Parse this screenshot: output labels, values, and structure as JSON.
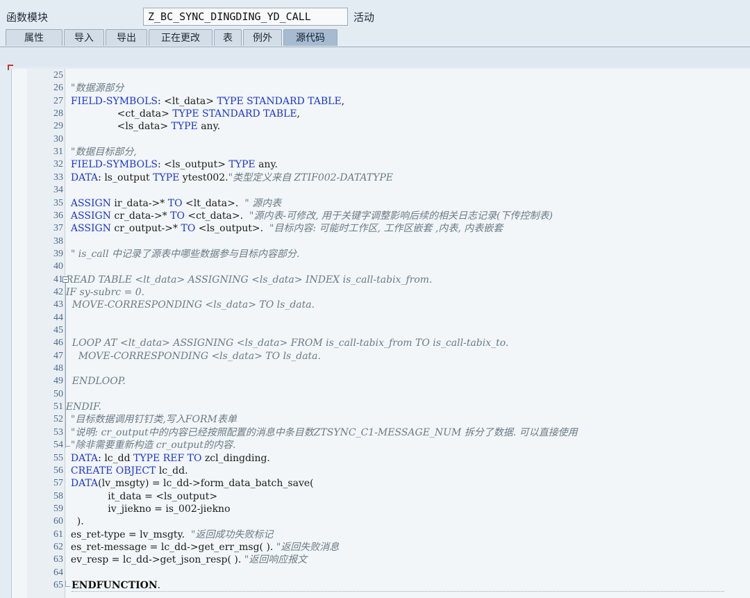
{
  "header": {
    "module_label": "函数模块",
    "function_name": "Z_BC_SYNC_DINGDING_YD_CALL",
    "status": "活动"
  },
  "tabs": [
    {
      "label": "属性",
      "active": false
    },
    {
      "label": "导入",
      "active": false
    },
    {
      "label": "导出",
      "active": false
    },
    {
      "label": "正在更改",
      "active": false
    },
    {
      "label": "表",
      "active": false
    },
    {
      "label": "例外",
      "active": false
    },
    {
      "label": "源代码",
      "active": true
    }
  ],
  "colors": {
    "keyword": "#1a35d6",
    "comment": "#6b7a86",
    "line_number": "#4a6a90",
    "active_tab": "#a6bbd0"
  },
  "code": [
    {
      "n": "25",
      "t": []
    },
    {
      "n": "26",
      "t": [
        [
          "cm",
          "  \"数据源部分"
        ]
      ]
    },
    {
      "n": "27",
      "t": [
        [
          "kw",
          "  FIELD-SYMBOLS"
        ],
        [
          "",
          ": <lt_data> "
        ],
        [
          "kw",
          "TYPE STANDARD TABLE"
        ],
        [
          "",
          ","
        ]
      ]
    },
    {
      "n": "28",
      "t": [
        [
          "",
          "                 <ct_data> "
        ],
        [
          "kw",
          "TYPE STANDARD TABLE"
        ],
        [
          "",
          ","
        ]
      ]
    },
    {
      "n": "29",
      "t": [
        [
          "",
          "                 <ls_data> "
        ],
        [
          "kw",
          "TYPE"
        ],
        [
          "",
          " any."
        ]
      ]
    },
    {
      "n": "30",
      "t": []
    },
    {
      "n": "31",
      "t": [
        [
          "cm",
          "  \"数据目标部分,"
        ]
      ]
    },
    {
      "n": "32",
      "t": [
        [
          "kw",
          "  FIELD-SYMBOLS"
        ],
        [
          "",
          ": <ls_output> "
        ],
        [
          "kw",
          "TYPE"
        ],
        [
          "",
          " any."
        ]
      ]
    },
    {
      "n": "33",
      "t": [
        [
          "kw",
          "  DATA"
        ],
        [
          "",
          ": ls_output "
        ],
        [
          "kw",
          "TYPE"
        ],
        [
          "",
          " ytest002."
        ],
        [
          "cm",
          "\"类型定义来自 ZTIF002-DATATYPE"
        ]
      ]
    },
    {
      "n": "34",
      "t": []
    },
    {
      "n": "35",
      "t": [
        [
          "kw",
          "  ASSIGN"
        ],
        [
          "",
          " ir_data->* "
        ],
        [
          "kw",
          "TO"
        ],
        [
          "",
          " <lt_data>.  "
        ],
        [
          "cm",
          "\" 源内表"
        ]
      ]
    },
    {
      "n": "36",
      "t": [
        [
          "kw",
          "  ASSIGN"
        ],
        [
          "",
          " cr_data->* "
        ],
        [
          "kw",
          "TO"
        ],
        [
          "",
          " <ct_data>.  "
        ],
        [
          "cm",
          "\"源内表-可修改, 用于关键字调整影响后续的相关日志记录(下传控制表)"
        ]
      ]
    },
    {
      "n": "37",
      "t": [
        [
          "kw",
          "  ASSIGN"
        ],
        [
          "",
          " cr_output->* "
        ],
        [
          "kw",
          "TO"
        ],
        [
          "",
          " <ls_output>.  "
        ],
        [
          "cm",
          "\"目标内容: 可能时工作区, 工作区嵌套 ,内表, 内表嵌套"
        ]
      ]
    },
    {
      "n": "38",
      "t": []
    },
    {
      "n": "39",
      "t": [
        [
          "cm",
          "  \" is_call 中记录了源表中哪些数据参与目标内容部分."
        ]
      ]
    },
    {
      "n": "40",
      "t": []
    },
    {
      "n": "41",
      "t": [
        [
          "cm",
          "*  READ TABLE <lt_data> ASSIGNING <ls_data> INDEX is_call-tabix_from."
        ]
      ]
    },
    {
      "n": "42",
      "t": [
        [
          "cm",
          "*  IF sy-subrc = 0."
        ]
      ]
    },
    {
      "n": "43",
      "t": [
        [
          "cm",
          "*    MOVE-CORRESPONDING <ls_data> TO ls_data."
        ]
      ]
    },
    {
      "n": "44",
      "t": [
        [
          "cm",
          "*"
        ]
      ]
    },
    {
      "n": "45",
      "t": [
        [
          "cm",
          "*"
        ]
      ]
    },
    {
      "n": "46",
      "t": [
        [
          "cm",
          "*    LOOP AT <lt_data> ASSIGNING <ls_data> FROM is_call-tabix_from TO is_call-tabix_to."
        ]
      ]
    },
    {
      "n": "47",
      "t": [
        [
          "cm",
          "*      MOVE-CORRESPONDING <ls_data> TO ls_data."
        ]
      ]
    },
    {
      "n": "48",
      "t": [
        [
          "cm",
          "*"
        ]
      ]
    },
    {
      "n": "49",
      "t": [
        [
          "cm",
          "*    ENDLOOP."
        ]
      ]
    },
    {
      "n": "50",
      "t": [
        [
          "cm",
          "*"
        ]
      ]
    },
    {
      "n": "51",
      "t": [
        [
          "cm",
          "*  ENDIF."
        ]
      ]
    },
    {
      "n": "52",
      "t": [
        [
          "cm",
          "  \"目标数据调用钉钉类,写入FORM表单"
        ]
      ]
    },
    {
      "n": "53",
      "t": [
        [
          "cm",
          "  \"说明: cr_output中的内容已经按照配置的消息中条目数ZTSYNC_C1-MESSAGE_NUM 拆分了数据. 可以直接使用"
        ]
      ]
    },
    {
      "n": "54",
      "t": [
        [
          "cm",
          "  \"除非需要重新构造 cr_output的内容."
        ]
      ]
    },
    {
      "n": "55",
      "t": [
        [
          "kw",
          "  DATA"
        ],
        [
          "",
          ": lc_dd "
        ],
        [
          "kw",
          "TYPE REF TO"
        ],
        [
          "",
          " zcl_dingding."
        ]
      ]
    },
    {
      "n": "56",
      "t": [
        [
          "kw",
          "  CREATE OBJECT"
        ],
        [
          "",
          " lc_dd."
        ]
      ]
    },
    {
      "n": "57",
      "t": [
        [
          "kw",
          "  DATA"
        ],
        [
          "",
          "(lv_msgty) = lc_dd->form_data_batch_save("
        ]
      ]
    },
    {
      "n": "58",
      "t": [
        [
          "",
          "              it_data = <ls_output>"
        ]
      ]
    },
    {
      "n": "59",
      "t": [
        [
          "",
          "              iv_jiekno = is_002-jiekno"
        ]
      ]
    },
    {
      "n": "60",
      "t": [
        [
          "",
          "    )."
        ]
      ]
    },
    {
      "n": "61",
      "t": [
        [
          "",
          "  es_ret-type = lv_msgty.  "
        ],
        [
          "cm",
          "\"返回成功失败标记"
        ]
      ]
    },
    {
      "n": "62",
      "t": [
        [
          "",
          "  es_ret-message = lc_dd->get_err_msg( ). "
        ],
        [
          "cm",
          "\"返回失败消息"
        ]
      ]
    },
    {
      "n": "63",
      "t": [
        [
          "",
          "  ev_resp = lc_dd->get_json_resp( ). "
        ],
        [
          "cm",
          "\"返回响应报文"
        ]
      ]
    },
    {
      "n": "64",
      "t": []
    },
    {
      "n": "65",
      "t": [
        [
          "bd",
          "ENDFUNCTION"
        ],
        [
          "",
          "."
        ]
      ]
    }
  ]
}
